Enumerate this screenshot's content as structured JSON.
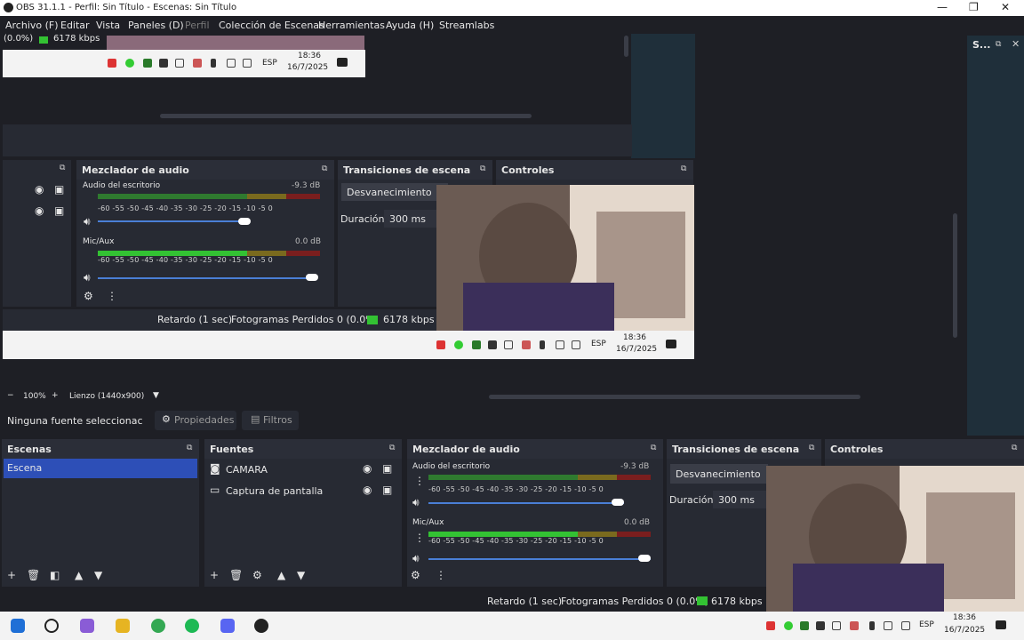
{
  "titlebar": {
    "title": "OBS 31.1.1 - Perfil: Sin Título - Escenas: Sin Título"
  },
  "menu": {
    "items": [
      "Archivo (F)",
      "Editar",
      "Vista",
      "Paneles (D)",
      "Perfil",
      "Colección de Escenas",
      "Herramientas",
      "Ayuda (H)",
      "Streamlabs"
    ]
  },
  "preview": {
    "top_status": {
      "dropped": "(0.0%)",
      "kbps": "6178 kbps"
    },
    "tray_time": "18:36",
    "tray_date": "16/7/2025",
    "tray_lang": "ESP",
    "inner_mixer_title": "Mezclador de audio",
    "inner_transitions_title": "Transiciones de escena",
    "inner_controls_title": "Controles",
    "inner_desktop_audio": "Audio del escritorio",
    "inner_desktop_db": "-9.3 dB",
    "inner_mic": "Mic/Aux",
    "inner_mic_db": "0.0 dB",
    "inner_scale": "-60  -55  -50  -45  -40  -35  -30  -25  -20  -15  -10   -5    0",
    "inner_fade": "Desvanecimiento",
    "inner_duration_label": "Duración",
    "inner_duration_value": "300 ms",
    "inner_status_delay": "Retardo (1 sec)",
    "inner_status_frames": "Fotogramas Perdidos 0 (0.0%)",
    "inner_status_kbps": "6178 kbps"
  },
  "zoombar": {
    "minus": "−",
    "zoom": "100%",
    "plus": "+",
    "canvas": "Lienzo (1440x900)"
  },
  "sourcebar": {
    "none_selected": "Ninguna fuente seleccionac",
    "properties": "Propiedades",
    "filters": "Filtros"
  },
  "scenes": {
    "title": "Escenas",
    "items": [
      "Escena"
    ]
  },
  "sources": {
    "title": "Fuentes",
    "items": [
      "CAMARA",
      "Captura de pantalla"
    ]
  },
  "mixer": {
    "title": "Mezclador de audio",
    "desktop_audio": "Audio del escritorio",
    "desktop_db": "-9.3 dB",
    "mic": "Mic/Aux",
    "mic_db": "0.0 dB",
    "scale": "-60  -55  -50  -45  -40  -35  -30  -25  -20  -15  -10   -5    0",
    "desktop_volume": 0.88,
    "mic_volume": 1.0
  },
  "transitions": {
    "title": "Transiciones de escena",
    "fade": "Desvanecimiento",
    "duration_label": "Duración",
    "duration_value": "300 ms"
  },
  "controls": {
    "title": "Controles"
  },
  "right_dock": {
    "title": "S..."
  },
  "statusbar": {
    "delay": "Retardo (1 sec)",
    "frames": "Fotogramas Perdidos 0 (0.0%)",
    "kbps": "6178 kbps"
  },
  "taskbar": {
    "time": "18:36",
    "date": "16/7/2025",
    "lang": "ESP"
  }
}
